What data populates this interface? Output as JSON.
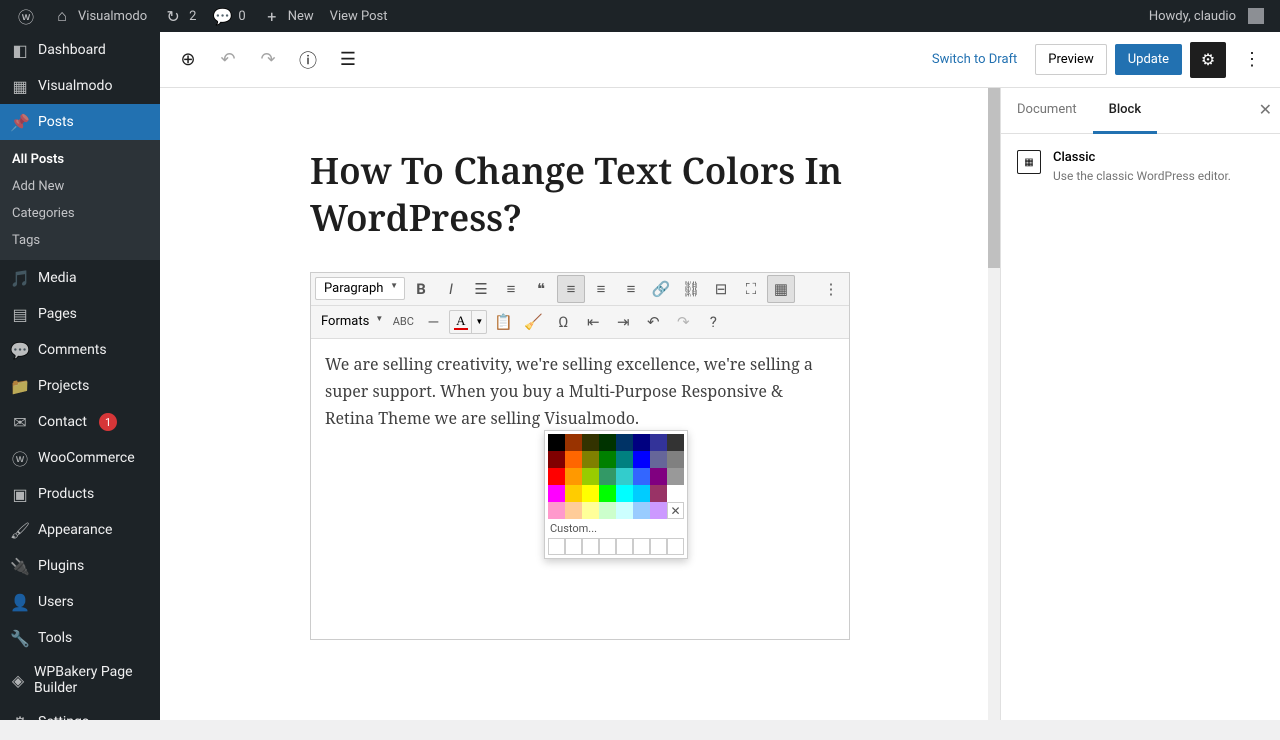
{
  "adminbar": {
    "site": "Visualmodo",
    "updates": "2",
    "comments": "0",
    "new": "New",
    "view": "View Post",
    "greeting": "Howdy, claudio"
  },
  "sidebar": {
    "items": [
      {
        "icon": "dashboard",
        "label": "Dashboard"
      },
      {
        "icon": "layout",
        "label": "Visualmodo"
      },
      {
        "icon": "pin",
        "label": "Posts",
        "current": true,
        "sub": [
          {
            "label": "All Posts",
            "current": true
          },
          {
            "label": "Add New"
          },
          {
            "label": "Categories"
          },
          {
            "label": "Tags"
          }
        ]
      },
      {
        "icon": "media",
        "label": "Media"
      },
      {
        "icon": "page",
        "label": "Pages"
      },
      {
        "icon": "comment",
        "label": "Comments"
      },
      {
        "icon": "folder",
        "label": "Projects"
      },
      {
        "icon": "mail",
        "label": "Contact",
        "badge": "1"
      },
      {
        "icon": "woo",
        "label": "WooCommerce"
      },
      {
        "icon": "product",
        "label": "Products"
      },
      {
        "icon": "brush",
        "label": "Appearance"
      },
      {
        "icon": "plug",
        "label": "Plugins"
      },
      {
        "icon": "user",
        "label": "Users"
      },
      {
        "icon": "wrench",
        "label": "Tools"
      },
      {
        "icon": "wpb",
        "label": "WPBakery Page Builder"
      },
      {
        "icon": "settings",
        "label": "Settings"
      }
    ]
  },
  "editor": {
    "header": {
      "switch_draft": "Switch to Draft",
      "preview": "Preview",
      "update": "Update"
    },
    "title": "How To Change Text Colors In WordPress?",
    "paragraph_selector": "Paragraph",
    "formats_selector": "Formats",
    "content": "We are selling creativity, we're selling excellence, we're selling a super support. When you buy a Multi-Purpose Responsive & Retina Theme we are selling Visualmodo.",
    "color_picker": {
      "rows": [
        [
          "#000000",
          "#993300",
          "#333300",
          "#003300",
          "#003366",
          "#000080",
          "#333399",
          "#333333"
        ],
        [
          "#800000",
          "#ff6600",
          "#808000",
          "#008000",
          "#008080",
          "#0000ff",
          "#666699",
          "#808080"
        ],
        [
          "#ff0000",
          "#ff9900",
          "#99cc00",
          "#339966",
          "#33cccc",
          "#3366ff",
          "#800080",
          "#999999"
        ],
        [
          "#ff00ff",
          "#ffcc00",
          "#ffff00",
          "#00ff00",
          "#00ffff",
          "#00ccff",
          "#993366",
          "#ffffff"
        ],
        [
          "#ff99cc",
          "#ffcc99",
          "#ffff99",
          "#ccffcc",
          "#ccffff",
          "#99ccff",
          "#cc99ff",
          ""
        ]
      ],
      "custom_label": "Custom..."
    }
  },
  "inspector": {
    "tabs": {
      "document": "Document",
      "block": "Block"
    },
    "block": {
      "title": "Classic",
      "desc": "Use the classic WordPress editor."
    }
  }
}
